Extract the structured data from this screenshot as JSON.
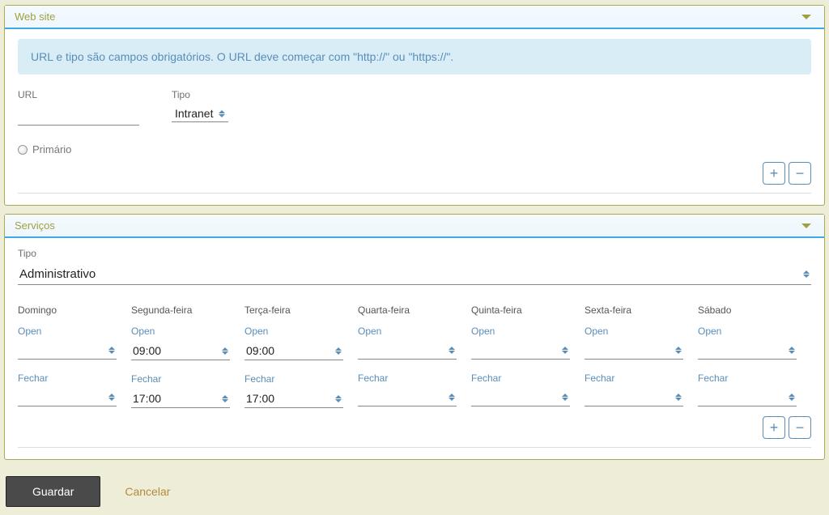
{
  "website": {
    "title": "Web site",
    "info": "URL e tipo são campos obrigatórios. O URL deve começar com \"http://\" ou \"https://\".",
    "url_label": "URL",
    "url_value": "",
    "tipo_label": "Tipo",
    "tipo_value": "Intranet",
    "primario_label": "Primário"
  },
  "servicos": {
    "title": "Serviços",
    "tipo_label": "Tipo",
    "tipo_value": "Administrativo",
    "open_label": "Open",
    "close_label": "Fechar",
    "days": [
      {
        "name": "Domingo",
        "open": "",
        "close": ""
      },
      {
        "name": "Segunda-feira",
        "open": "09:00",
        "close": "17:00"
      },
      {
        "name": "Terça-feira",
        "open": "09:00",
        "close": "17:00"
      },
      {
        "name": "Quarta-feira",
        "open": "",
        "close": ""
      },
      {
        "name": "Quinta-feira",
        "open": "",
        "close": ""
      },
      {
        "name": "Sexta-feira",
        "open": "",
        "close": ""
      },
      {
        "name": "Sábado",
        "open": "",
        "close": ""
      }
    ]
  },
  "actions": {
    "save": "Guardar",
    "cancel": "Cancelar"
  }
}
